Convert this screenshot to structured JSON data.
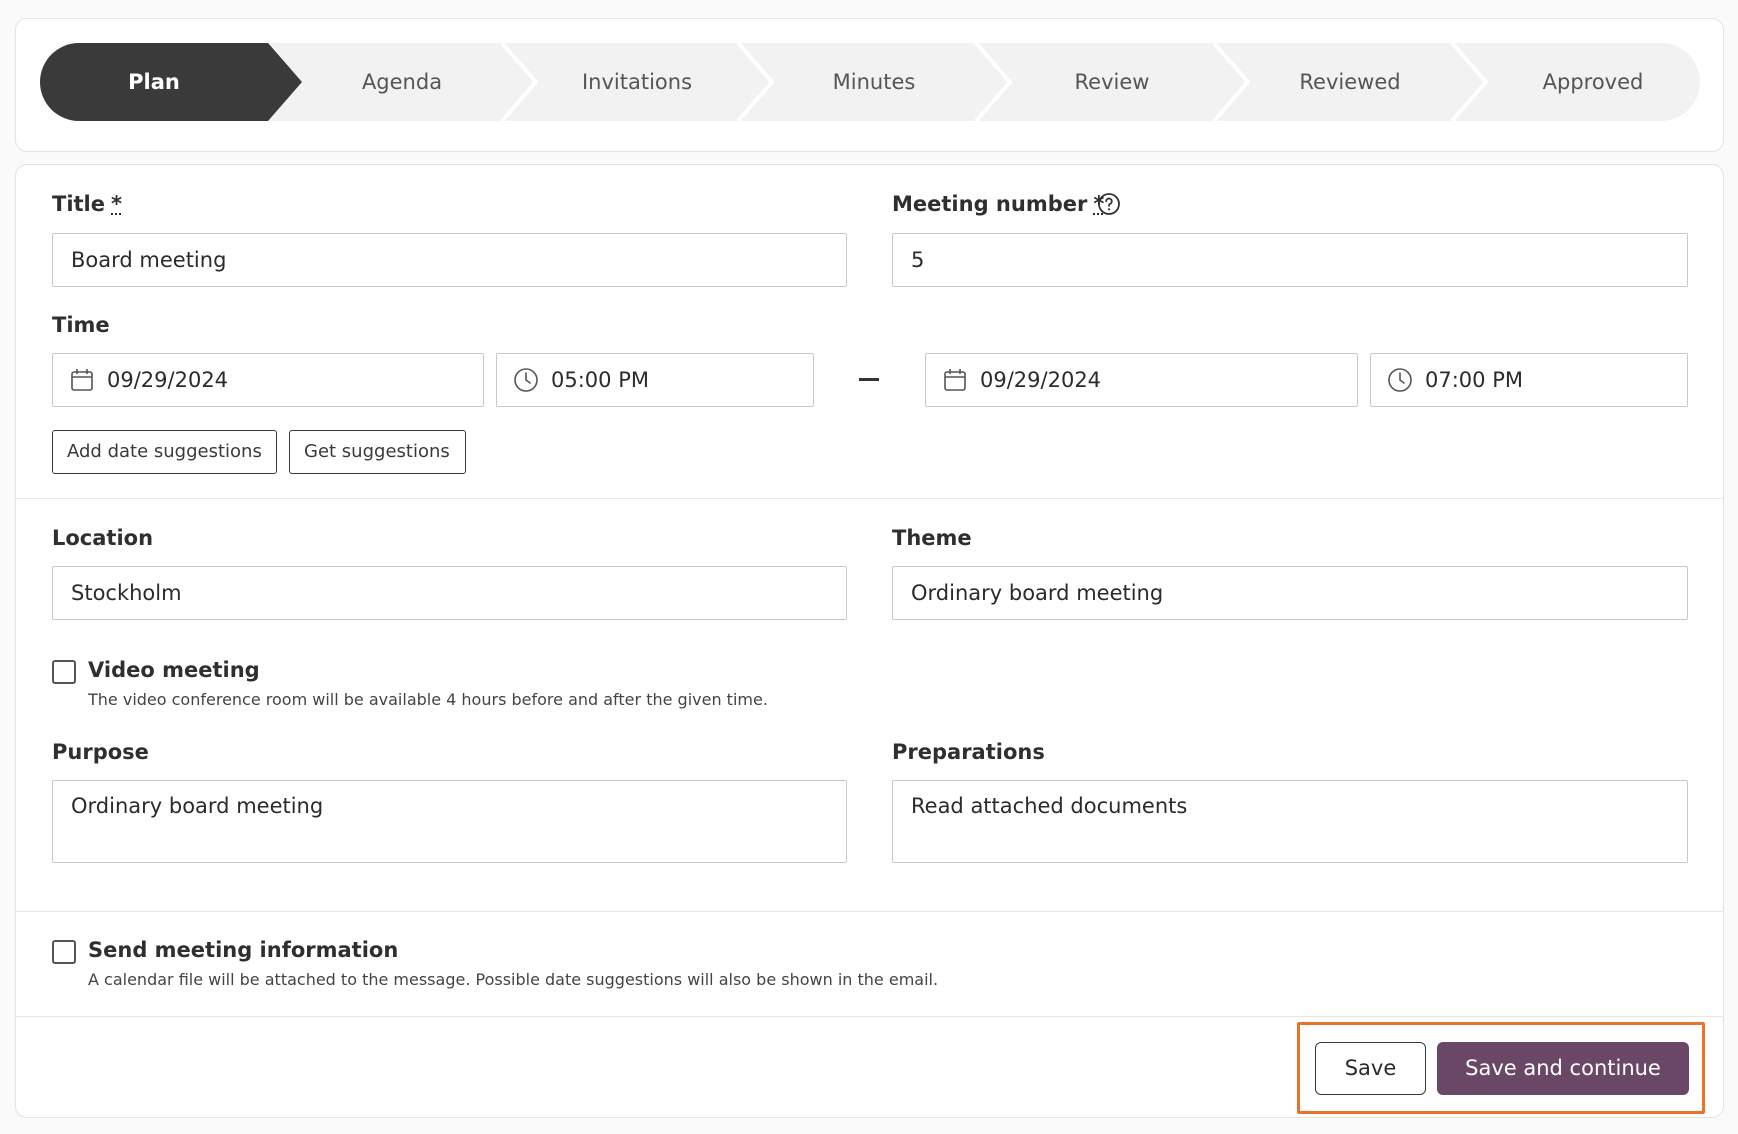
{
  "steps": [
    "Plan",
    "Agenda",
    "Invitations",
    "Minutes",
    "Review",
    "Reviewed",
    "Approved"
  ],
  "active_step": "Plan",
  "form": {
    "title_label": "Title",
    "required_mark": "*",
    "title_value": "Board meeting",
    "meeting_number_label": "Meeting number",
    "meeting_number_value": "5",
    "time_label": "Time",
    "start_date": "09/29/2024",
    "start_time": "05:00 PM",
    "end_date": "09/29/2024",
    "end_time": "07:00 PM",
    "add_date_suggestions": "Add date suggestions",
    "get_suggestions": "Get suggestions",
    "location_label": "Location",
    "location_value": "Stockholm",
    "theme_label": "Theme",
    "theme_value": "Ordinary board meeting",
    "video_meeting_label": "Video meeting",
    "video_meeting_help": "The video conference room will be available 4 hours before and after the given time.",
    "purpose_label": "Purpose",
    "purpose_value": "Ordinary board meeting",
    "preparations_label": "Preparations",
    "preparations_value": "Read attached documents",
    "send_info_label": "Send meeting information",
    "send_info_help": "A calendar file will be attached to the message. Possible date suggestions will also be shown in the email."
  },
  "actions": {
    "save": "Save",
    "save_continue": "Save and continue"
  },
  "colors": {
    "active_step": "#3a3a3a",
    "primary_button": "#6a4766",
    "highlight": "#e8742c"
  }
}
